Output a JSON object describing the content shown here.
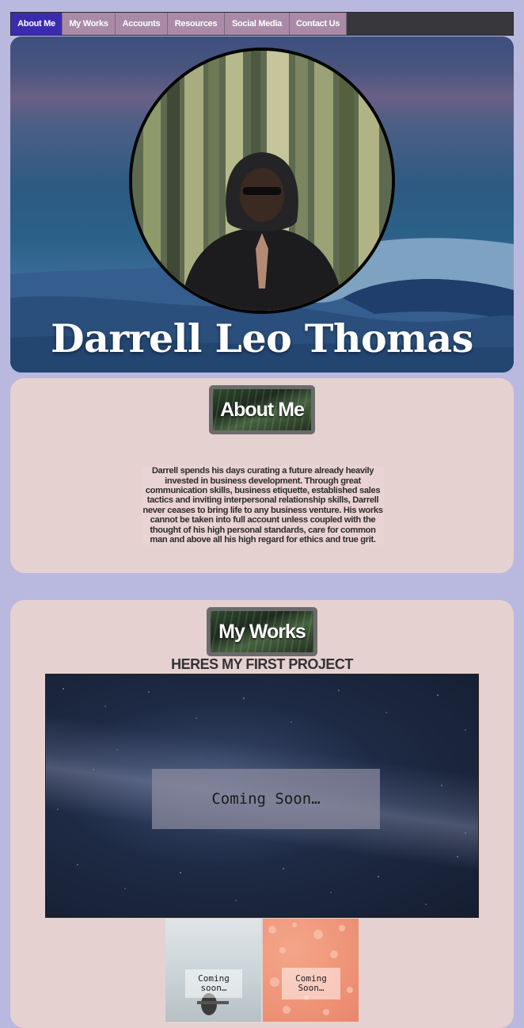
{
  "nav": {
    "items": [
      {
        "label": "About Me",
        "active": true
      },
      {
        "label": "My Works",
        "active": false
      },
      {
        "label": "Accounts",
        "active": false
      },
      {
        "label": "Resources",
        "active": false
      },
      {
        "label": "Social Media",
        "active": false
      },
      {
        "label": "Contact Us",
        "active": false
      }
    ]
  },
  "hero": {
    "name": "Darrell Leo Thomas"
  },
  "about": {
    "title": "About Me",
    "text": "Darrell spends his days curating a future already heavily invested in business development. Through great communication skills, business etiquette, established sales tactics and inviting interpersonal relationship skills, Darrell never ceases to bring life to any business venture. His works cannot be taken into full account unless coupled with the thought of his high personal standards, care for common man and above all his high regard for ethics and true grit."
  },
  "works": {
    "title": "My Works",
    "heading": "HERES MY FIRST PROJECT",
    "main_project": {
      "overlay": "Coming Soon…"
    },
    "thumbnails": [
      {
        "overlay": "Coming soon…"
      },
      {
        "overlay": "Coming Soon…"
      }
    ]
  },
  "colors": {
    "background": "#b9b9df",
    "panel": "#e6d1d1",
    "nav_active": "#3a2bb0",
    "nav_item": "#a98ba8",
    "nav_bar": "#38383c"
  }
}
